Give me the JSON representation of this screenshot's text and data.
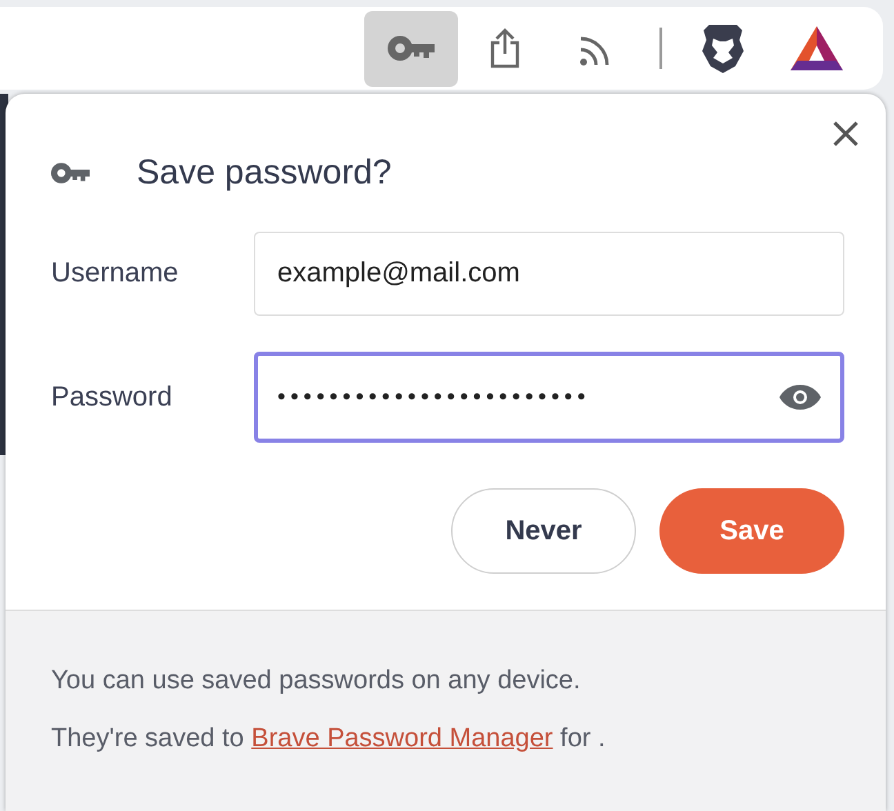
{
  "toolbar": {
    "buttons": [
      {
        "kind": "key",
        "selected": true
      },
      {
        "kind": "share",
        "selected": false
      },
      {
        "kind": "cast",
        "selected": false
      },
      {
        "kind": "divider",
        "selected": false
      },
      {
        "kind": "lion",
        "selected": false
      },
      {
        "kind": "triangle",
        "selected": false
      }
    ]
  },
  "dialog": {
    "title": "Save password?",
    "fields": [
      {
        "label": "Username",
        "value": "example@mail.com",
        "focused": false,
        "reveal": false
      },
      {
        "label": "Password",
        "value": "••••••••••••••••••••••••",
        "focused": true,
        "reveal": true
      }
    ],
    "buttons": [
      {
        "label": "Never",
        "kind": "secondary"
      },
      {
        "label": "Save",
        "kind": "primary"
      }
    ],
    "footer": {
      "line1": "You can use saved passwords on any device.",
      "line2_before": "They're saved to ",
      "link": "Brave Password Manager",
      "line2_after": " for ."
    }
  }
}
